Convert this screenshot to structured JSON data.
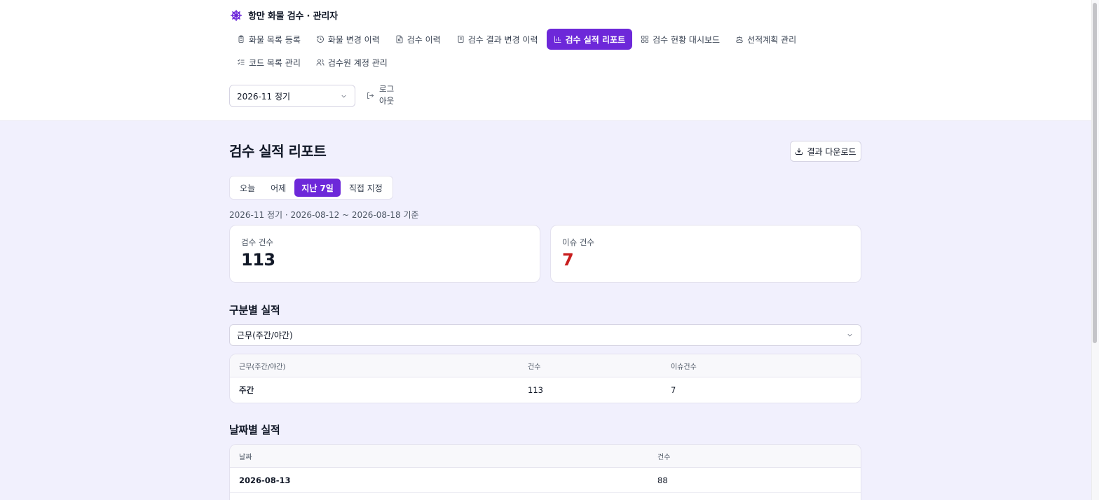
{
  "app": {
    "title": "항만 화물 검수 · 관리자",
    "logo_icon": "ship-wheel-icon",
    "accent_color": "#6d28d9"
  },
  "nav": [
    {
      "label": "화물 목록 등록",
      "icon": "clipboard-list-icon",
      "active": false
    },
    {
      "label": "화물 변경 이력",
      "icon": "history-icon",
      "active": false
    },
    {
      "label": "검수 이력",
      "icon": "file-search-icon",
      "active": false
    },
    {
      "label": "검수 결과 변경 이력",
      "icon": "scroll-icon",
      "active": false
    },
    {
      "label": "검수 실적 리포트",
      "icon": "bar-chart-icon",
      "active": true
    },
    {
      "label": "검수 현황 대시보드",
      "icon": "layout-grid-icon",
      "active": false
    },
    {
      "label": "선적계획 관리",
      "icon": "ship-icon",
      "active": false
    },
    {
      "label": "코드 목록 관리",
      "icon": "list-checks-icon",
      "active": false
    },
    {
      "label": "검수원 계정 관리",
      "icon": "users-icon",
      "active": false
    }
  ],
  "period_select": {
    "value": "2026-11 정기"
  },
  "logout": {
    "label": "로그아웃"
  },
  "page": {
    "title": "검수 실적 리포트",
    "download_label": "결과 다운로드"
  },
  "range_tabs": [
    {
      "label": "오늘",
      "active": false
    },
    {
      "label": "어제",
      "active": false
    },
    {
      "label": "지난 7일",
      "active": true
    },
    {
      "label": "직접 지정",
      "active": false
    }
  ],
  "range_caption": "2026-11 정기 · 2026-08-12 ~ 2026-08-18 기준",
  "stats": {
    "inspections": {
      "label": "검수 건수",
      "value": "113"
    },
    "issues": {
      "label": "이슈 건수",
      "value": "7",
      "color": "#c81e1e"
    }
  },
  "by_category": {
    "title": "구분별 실적",
    "select_value": "근무(주간/야간)",
    "columns": [
      "근무(주간/야간)",
      "건수",
      "이슈건수"
    ],
    "rows": [
      [
        "주간",
        "113",
        "7"
      ]
    ]
  },
  "by_date": {
    "title": "날짜별 실적",
    "columns": [
      "날짜",
      "건수"
    ],
    "rows": [
      [
        "2026-08-13",
        "88"
      ]
    ]
  }
}
